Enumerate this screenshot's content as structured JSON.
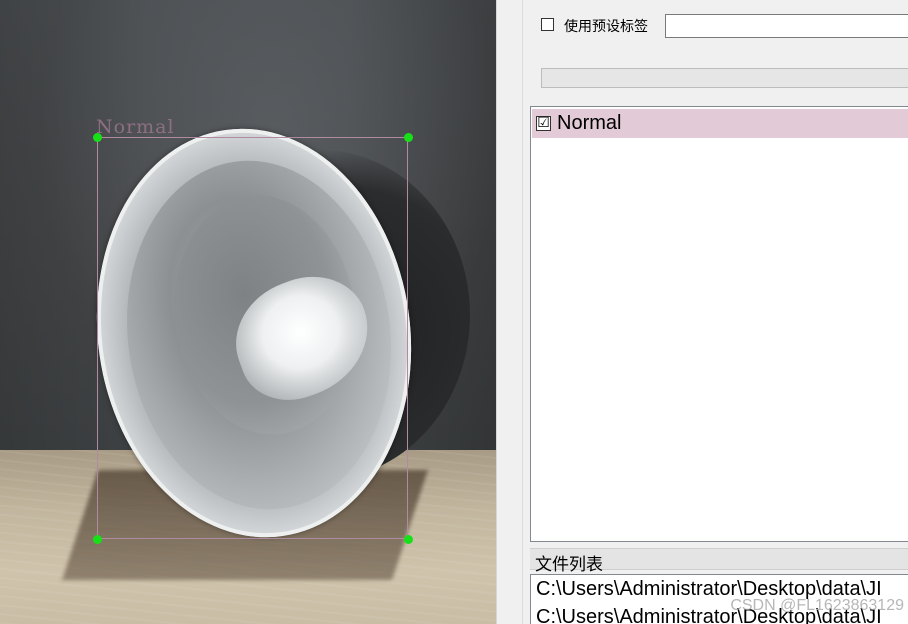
{
  "canvas": {
    "box_label": "Normal"
  },
  "dock": {
    "preset_checkbox_label": "使用预设标签",
    "preset_input_value": "",
    "labels": [
      {
        "text": "Normal",
        "checked": true,
        "check_glyph": "☑"
      }
    ],
    "file_list_title": "文件列表",
    "files": [
      "C:\\Users\\Administrator\\Desktop\\data\\JI",
      "C:\\Users\\Administrator\\Desktop\\data\\JI"
    ]
  },
  "watermark": "CSDN @FL1623863129",
  "colors": {
    "label_highlight": "#e2cad6",
    "bbox_line": "#b08aa0",
    "handle": "#18e018"
  }
}
